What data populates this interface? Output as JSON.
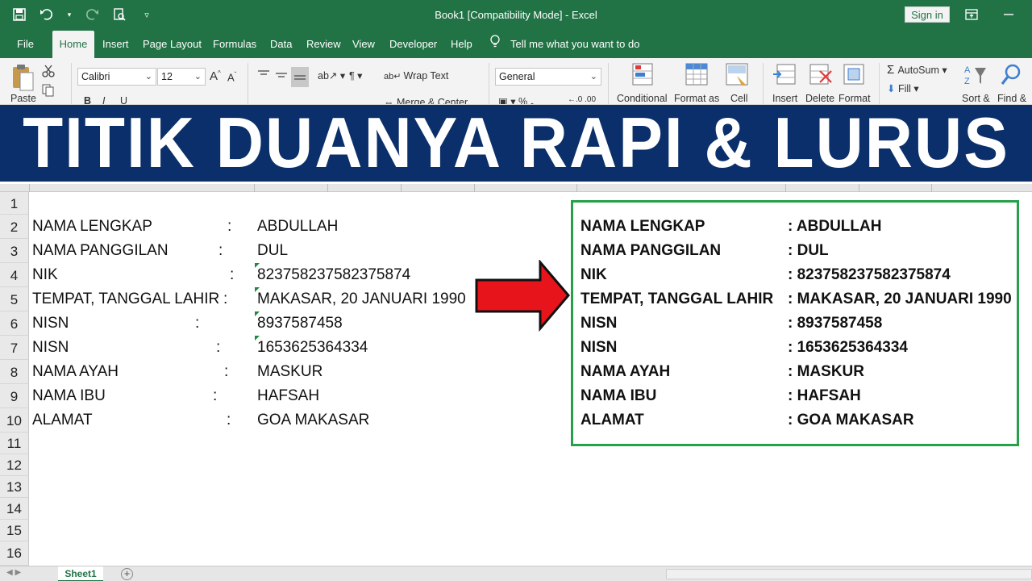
{
  "window": {
    "title": "Book1  [Compatibility Mode]  -  Excel",
    "signin_label": "Sign in"
  },
  "ribbon_tabs": [
    {
      "label": "File"
    },
    {
      "label": "Home"
    },
    {
      "label": "Insert"
    },
    {
      "label": "Page Layout"
    },
    {
      "label": "Formulas"
    },
    {
      "label": "Data"
    },
    {
      "label": "Review"
    },
    {
      "label": "View"
    },
    {
      "label": "Developer"
    },
    {
      "label": "Help"
    }
  ],
  "tell_me": "Tell me what you want to do",
  "ribbon": {
    "paste": "Paste",
    "font_name": "Calibri",
    "font_size": "12",
    "wrap_text": "Wrap Text",
    "merge_center": "Merge & Center",
    "number_format": "General",
    "conditional": "Conditional",
    "format_as": "Format as",
    "cell": "Cell",
    "insert": "Insert",
    "delete": "Delete",
    "format": "Format",
    "autosum": "AutoSum",
    "fill": "Fill",
    "sort": "Sort &",
    "find": "Find &"
  },
  "banner": "TITIK DUANYA RAPI & LURUS",
  "row_numbers": [
    "1",
    "2",
    "3",
    "4",
    "5",
    "6",
    "7",
    "8",
    "9",
    "10",
    "11",
    "12",
    "13",
    "14",
    "15",
    "16"
  ],
  "left_table": [
    {
      "label": "NAMA LENGKAP",
      "colon": ":",
      "value": "ABDULLAH"
    },
    {
      "label": "NAMA PANGGILAN",
      "colon": ":",
      "value": "DUL"
    },
    {
      "label": "NIK",
      "colon": ":",
      "value": "823758237582375874"
    },
    {
      "label": "TEMPAT, TANGGAL LAHIR",
      "colon": ":",
      "value": "MAKASAR, 20 JANUARI 1990"
    },
    {
      "label": "NISN",
      "colon": ":",
      "value": "8937587458"
    },
    {
      "label": "NISN",
      "colon": ":",
      "value": "1653625364334"
    },
    {
      "label": "NAMA AYAH",
      "colon": ":",
      "value": "MASKUR"
    },
    {
      "label": "NAMA IBU",
      "colon": ":",
      "value": "HAFSAH"
    },
    {
      "label": "ALAMAT",
      "colon": ":",
      "value": "GOA MAKASAR"
    }
  ],
  "right_table": [
    {
      "label": "NAMA LENGKAP",
      "value": ": ABDULLAH"
    },
    {
      "label": "NAMA PANGGILAN",
      "value": ": DUL"
    },
    {
      "label": "NIK",
      "value": ": 823758237582375874"
    },
    {
      "label": "TEMPAT, TANGGAL LAHIR",
      "value": ": MAKASAR, 20 JANUARI 1990"
    },
    {
      "label": "NISN",
      "value": ": 8937587458"
    },
    {
      "label": "NISN",
      "value": ": 1653625364334"
    },
    {
      "label": "NAMA AYAH",
      "value": ": MASKUR"
    },
    {
      "label": "NAMA IBU",
      "value": ": HAFSAH"
    },
    {
      "label": "ALAMAT",
      "value": ": GOA MAKASAR"
    }
  ],
  "sheet_tab": "Sheet1",
  "colors": {
    "excel_green": "#217346",
    "banner_bg": "#0b2f6a",
    "arrow_red": "#e8141b",
    "result_border": "#27a04a"
  }
}
